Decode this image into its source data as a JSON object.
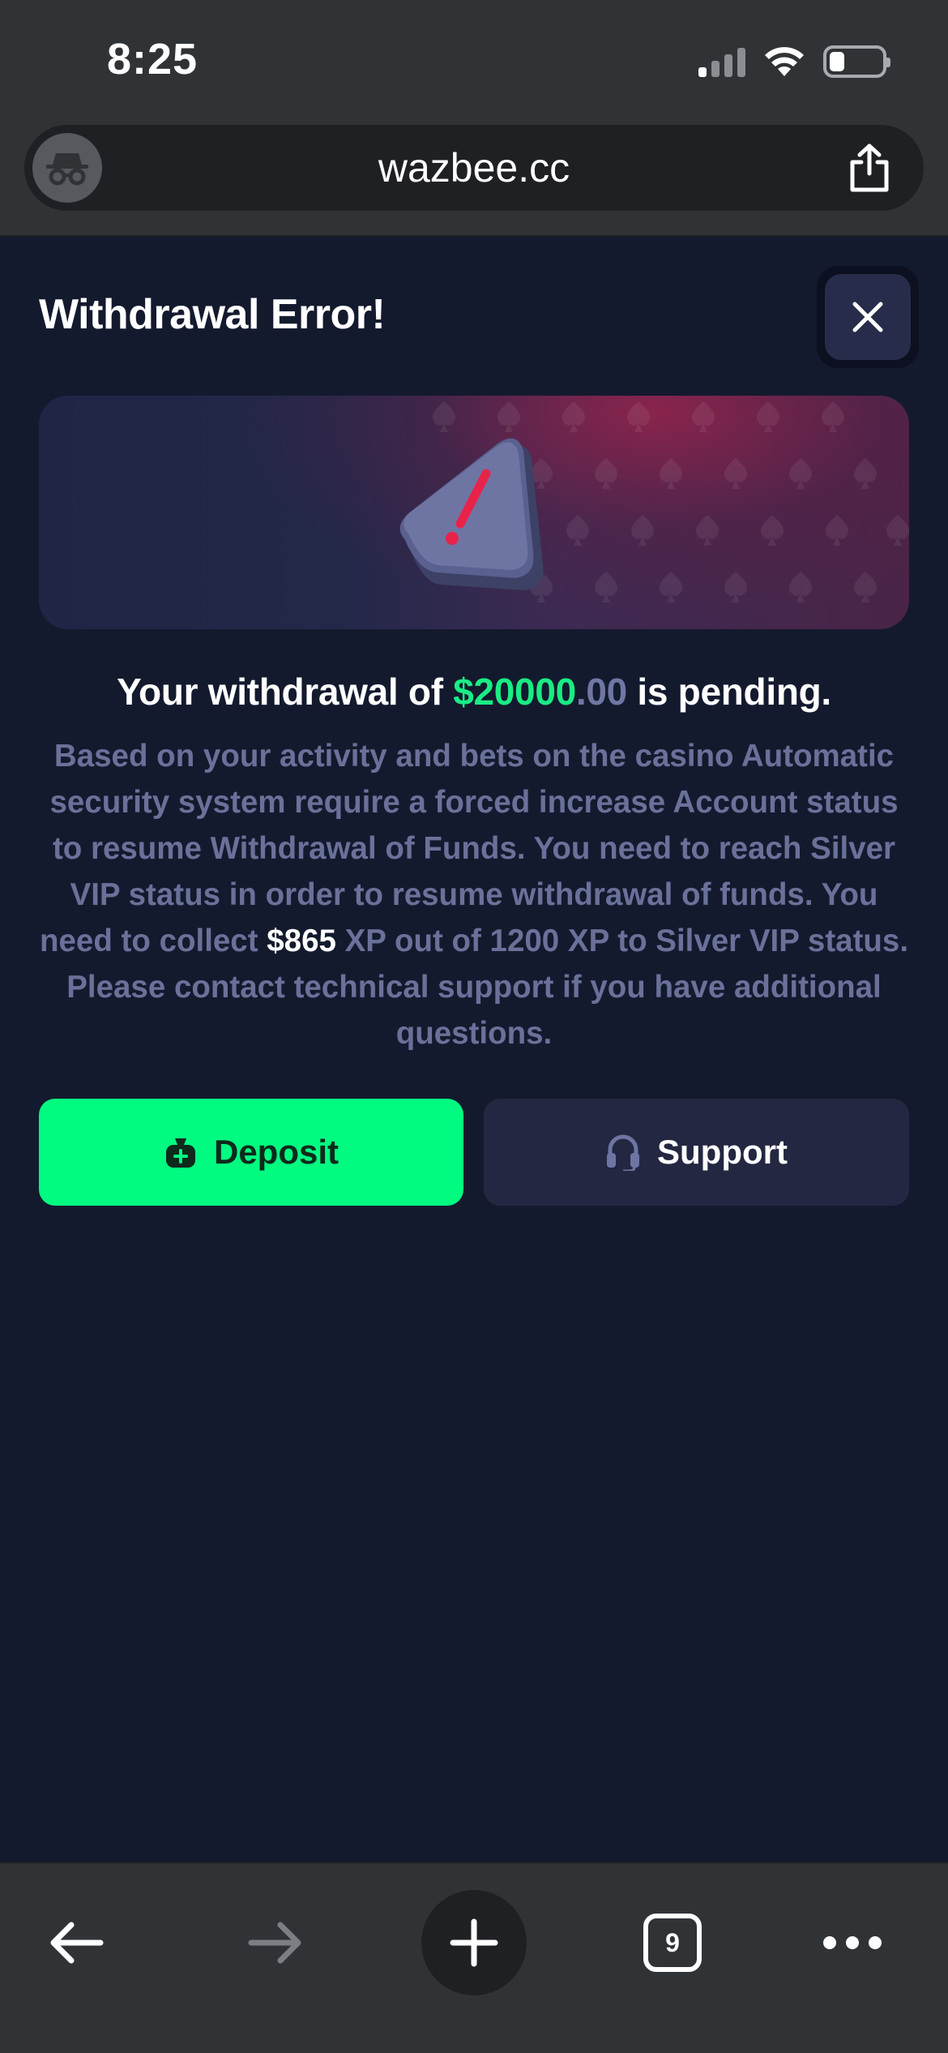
{
  "status_bar": {
    "time": "8:25"
  },
  "browser": {
    "url": "wazbee.cc",
    "tab_count": "9",
    "icons": [
      "incognito-icon",
      "share-icon",
      "back-arrow-icon",
      "forward-arrow-icon",
      "plus-icon",
      "tabs-icon",
      "more-icon"
    ]
  },
  "modal": {
    "title": "Withdrawal Error!",
    "headline": {
      "prefix": "Your withdrawal of ",
      "amount_main": "$20000",
      "amount_cents": ".00",
      "suffix": " is pending."
    },
    "body": {
      "part1": "Based on your activity and bets on the casino Automatic security system require a forced increase Account status to resume Withdrawal of Funds. You need to reach Silver VIP status in order to resume withdrawal of funds. You need to collect ",
      "highlight": "$865",
      "part2": " XP out of 1200 XP to Silver VIP status. Please contact technical support if you have additional questions."
    },
    "buttons": {
      "deposit_label": "Deposit",
      "support_label": "Support"
    }
  },
  "colors": {
    "background": "#141a2e",
    "accent_green": "#00fb80",
    "amount_green": "#19ec84",
    "muted_text": "#6a7199",
    "warning_red": "#e8234a"
  }
}
